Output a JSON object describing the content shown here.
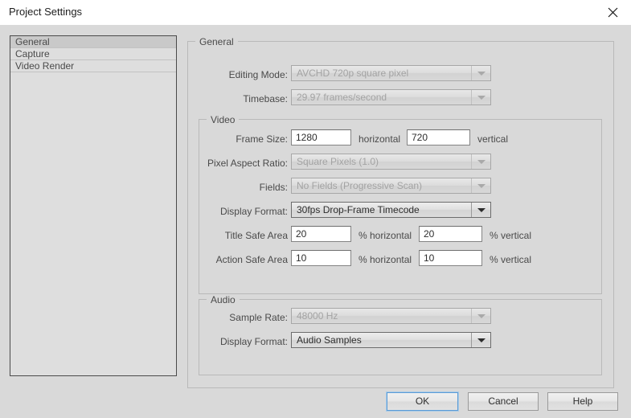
{
  "window": {
    "title": "Project Settings",
    "close_icon": "close-icon"
  },
  "sidebar": {
    "items": [
      {
        "label": "General",
        "selected": true
      },
      {
        "label": "Capture",
        "selected": false
      },
      {
        "label": "Video Render",
        "selected": false
      }
    ]
  },
  "groups": {
    "general": {
      "title": "General",
      "fields": {
        "editing_mode": {
          "label": "Editing Mode:",
          "value": "AVCHD 720p square pixel",
          "enabled": false
        },
        "timebase": {
          "label": "Timebase:",
          "value": "29.97 frames/second",
          "enabled": false
        }
      }
    },
    "video": {
      "title": "Video",
      "fields": {
        "frame_size": {
          "label": "Frame Size:",
          "horizontal_value": "1280",
          "horizontal_suffix": "horizontal",
          "vertical_value": "720",
          "vertical_suffix": "vertical"
        },
        "pixel_aspect_ratio": {
          "label": "Pixel Aspect Ratio:",
          "value": "Square Pixels (1.0)",
          "enabled": false
        },
        "fields": {
          "label": "Fields:",
          "value": "No Fields (Progressive Scan)",
          "enabled": false
        },
        "display_format": {
          "label": "Display Format:",
          "value": "30fps Drop-Frame Timecode",
          "enabled": true
        },
        "title_safe_area": {
          "label": "Title Safe Area",
          "horizontal_value": "20",
          "horizontal_suffix": "% horizontal",
          "vertical_value": "20",
          "vertical_suffix": "% vertical"
        },
        "action_safe_area": {
          "label": "Action Safe Area",
          "horizontal_value": "10",
          "horizontal_suffix": "% horizontal",
          "vertical_value": "10",
          "vertical_suffix": "% vertical"
        }
      }
    },
    "audio": {
      "title": "Audio",
      "fields": {
        "sample_rate": {
          "label": "Sample Rate:",
          "value": "48000 Hz",
          "enabled": false
        },
        "display_format": {
          "label": "Display Format:",
          "value": "Audio Samples",
          "enabled": true
        }
      }
    }
  },
  "buttons": {
    "ok": "OK",
    "cancel": "Cancel",
    "help": "Help"
  },
  "colors": {
    "dialog_background": "#d9d9d9",
    "titlebar_background": "#ffffff",
    "accent_focus": "#5b9bd5",
    "text": "#4a4a4a",
    "disabled_text": "#a3a3a3"
  }
}
